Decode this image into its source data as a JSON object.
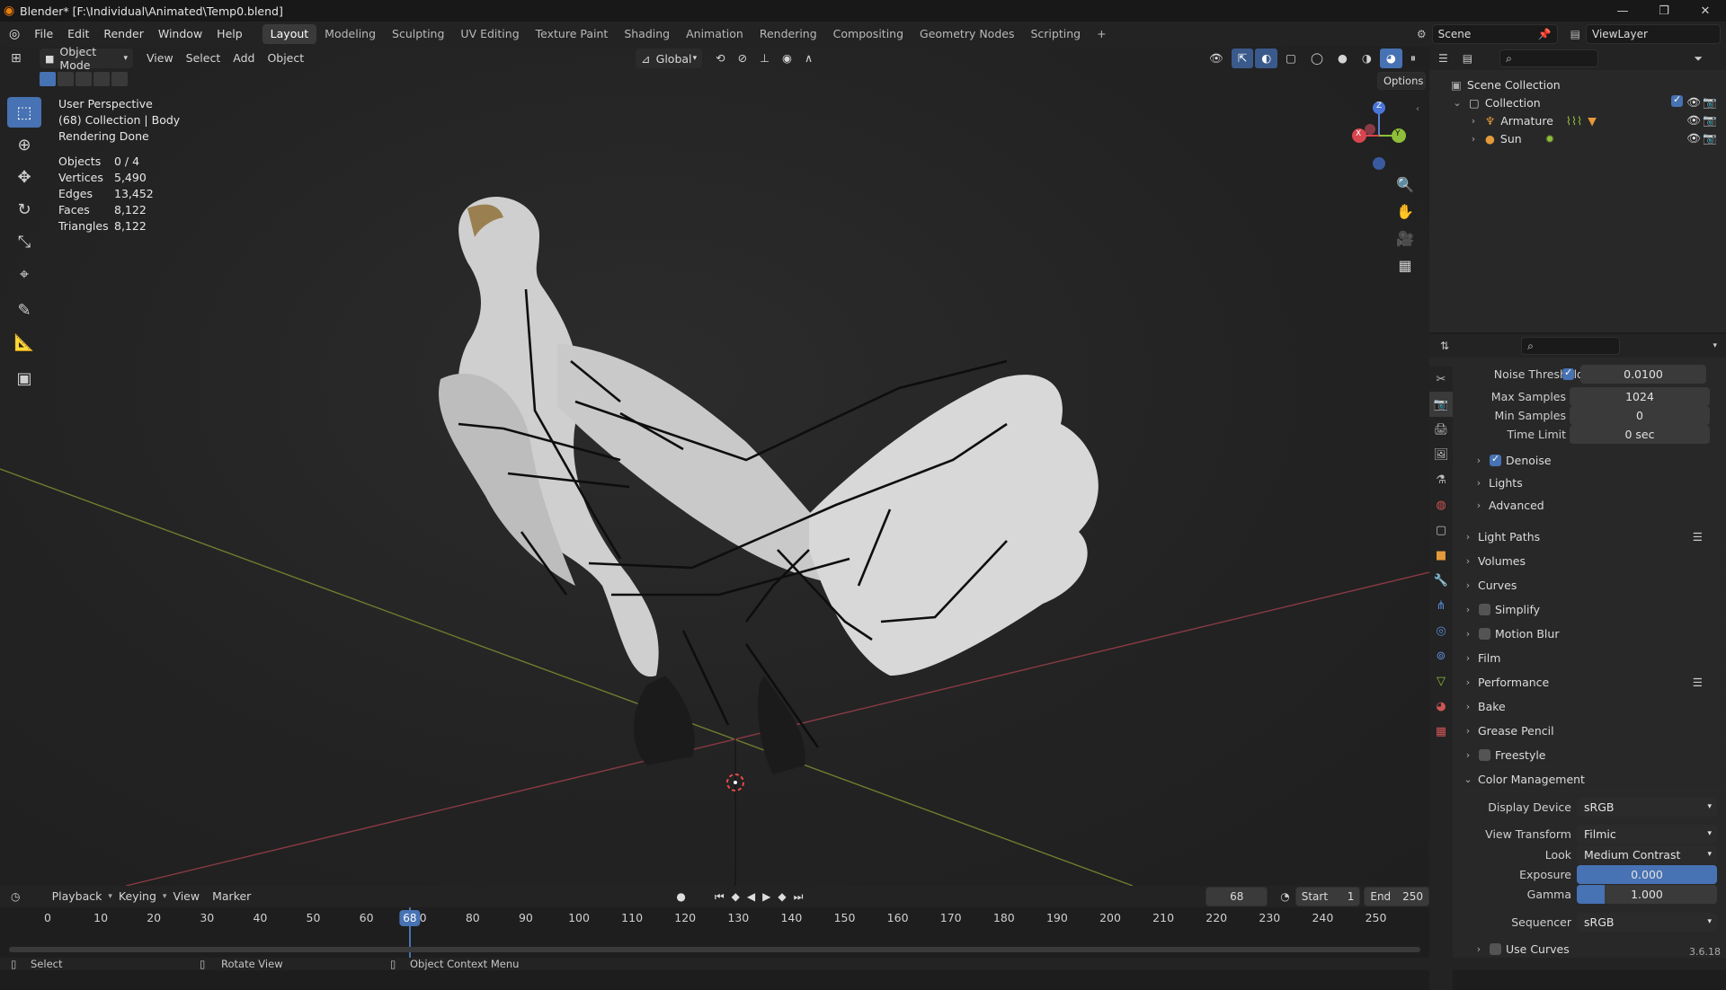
{
  "window": {
    "title": "Blender* [F:\\Individual\\Animated\\Temp0.blend]",
    "minimize": "—",
    "maximize": "❐",
    "close": "✕"
  },
  "menu": {
    "items": [
      "File",
      "Edit",
      "Render",
      "Window",
      "Help"
    ],
    "workspaces": [
      "Layout",
      "Modeling",
      "Sculpting",
      "UV Editing",
      "Texture Paint",
      "Shading",
      "Animation",
      "Rendering",
      "Compositing",
      "Geometry Nodes",
      "Scripting"
    ],
    "active_workspace": "Layout",
    "add_tab": "+",
    "scene": "Scene",
    "view_layer": "ViewLayer"
  },
  "viewport_header": {
    "mode": "Object Mode",
    "menus": [
      "View",
      "Select",
      "Add",
      "Object"
    ],
    "orientation": "Global",
    "options": "Options"
  },
  "viewport_overlay": {
    "perspective": "User Perspective",
    "collection": "(68) Collection | Body",
    "render_status": "Rendering Done",
    "stats": [
      {
        "key": "Objects",
        "value": "0 / 4"
      },
      {
        "key": "Vertices",
        "value": "5,490"
      },
      {
        "key": "Edges",
        "value": "13,452"
      },
      {
        "key": "Faces",
        "value": "8,122"
      },
      {
        "key": "Triangles",
        "value": "8,122"
      }
    ],
    "gizmo": {
      "x": "X",
      "y": "Y",
      "z": "Z"
    }
  },
  "outliner": {
    "root": "Scene Collection",
    "items": [
      {
        "label": "Collection"
      },
      {
        "label": "Armature"
      },
      {
        "label": "Sun"
      }
    ]
  },
  "properties": {
    "sampling": [
      {
        "label": "Noise Threshold",
        "value": "0.0100",
        "checkbox": true
      },
      {
        "label": "Max Samples",
        "value": "1024"
      },
      {
        "label": "Min Samples",
        "value": "0"
      },
      {
        "label": "Time Limit",
        "value": "0 sec"
      }
    ],
    "sub_panels": [
      {
        "label": "Denoise",
        "checkbox": true
      },
      {
        "label": "Lights"
      },
      {
        "label": "Advanced"
      }
    ],
    "panels": [
      {
        "label": "Light Paths",
        "has_list": true
      },
      {
        "label": "Volumes"
      },
      {
        "label": "Curves"
      },
      {
        "label": "Simplify",
        "checkbox": true
      },
      {
        "label": "Motion Blur",
        "checkbox": true
      },
      {
        "label": "Film"
      },
      {
        "label": "Performance",
        "has_list": true
      },
      {
        "label": "Bake"
      },
      {
        "label": "Grease Pencil"
      },
      {
        "label": "Freestyle",
        "checkbox": true
      }
    ],
    "color_management": {
      "title": "Color Management",
      "display_device_label": "Display Device",
      "display_device": "sRGB",
      "view_transform_label": "View Transform",
      "view_transform": "Filmic",
      "look_label": "Look",
      "look": "Medium Contrast",
      "exposure_label": "Exposure",
      "exposure": "0.000",
      "gamma_label": "Gamma",
      "gamma": "1.000",
      "sequencer_label": "Sequencer",
      "sequencer": "sRGB",
      "use_curves": "Use Curves"
    }
  },
  "timeline": {
    "menus": [
      "Playback",
      "Keying",
      "View",
      "Marker"
    ],
    "current_frame": "68",
    "start_label": "Start",
    "start": "1",
    "end_label": "End",
    "end": "250",
    "ticks": [
      "0",
      "10",
      "20",
      "30",
      "40",
      "50",
      "60",
      "70",
      "80",
      "90",
      "100",
      "110",
      "120",
      "130",
      "140",
      "150",
      "160",
      "170",
      "180",
      "190",
      "200",
      "210",
      "220",
      "230",
      "240",
      "250"
    ],
    "playhead_label": "68"
  },
  "statusbar": {
    "select": "Select",
    "rotate": "Rotate View",
    "context": "Object Context Menu",
    "version": "3.6.18"
  }
}
